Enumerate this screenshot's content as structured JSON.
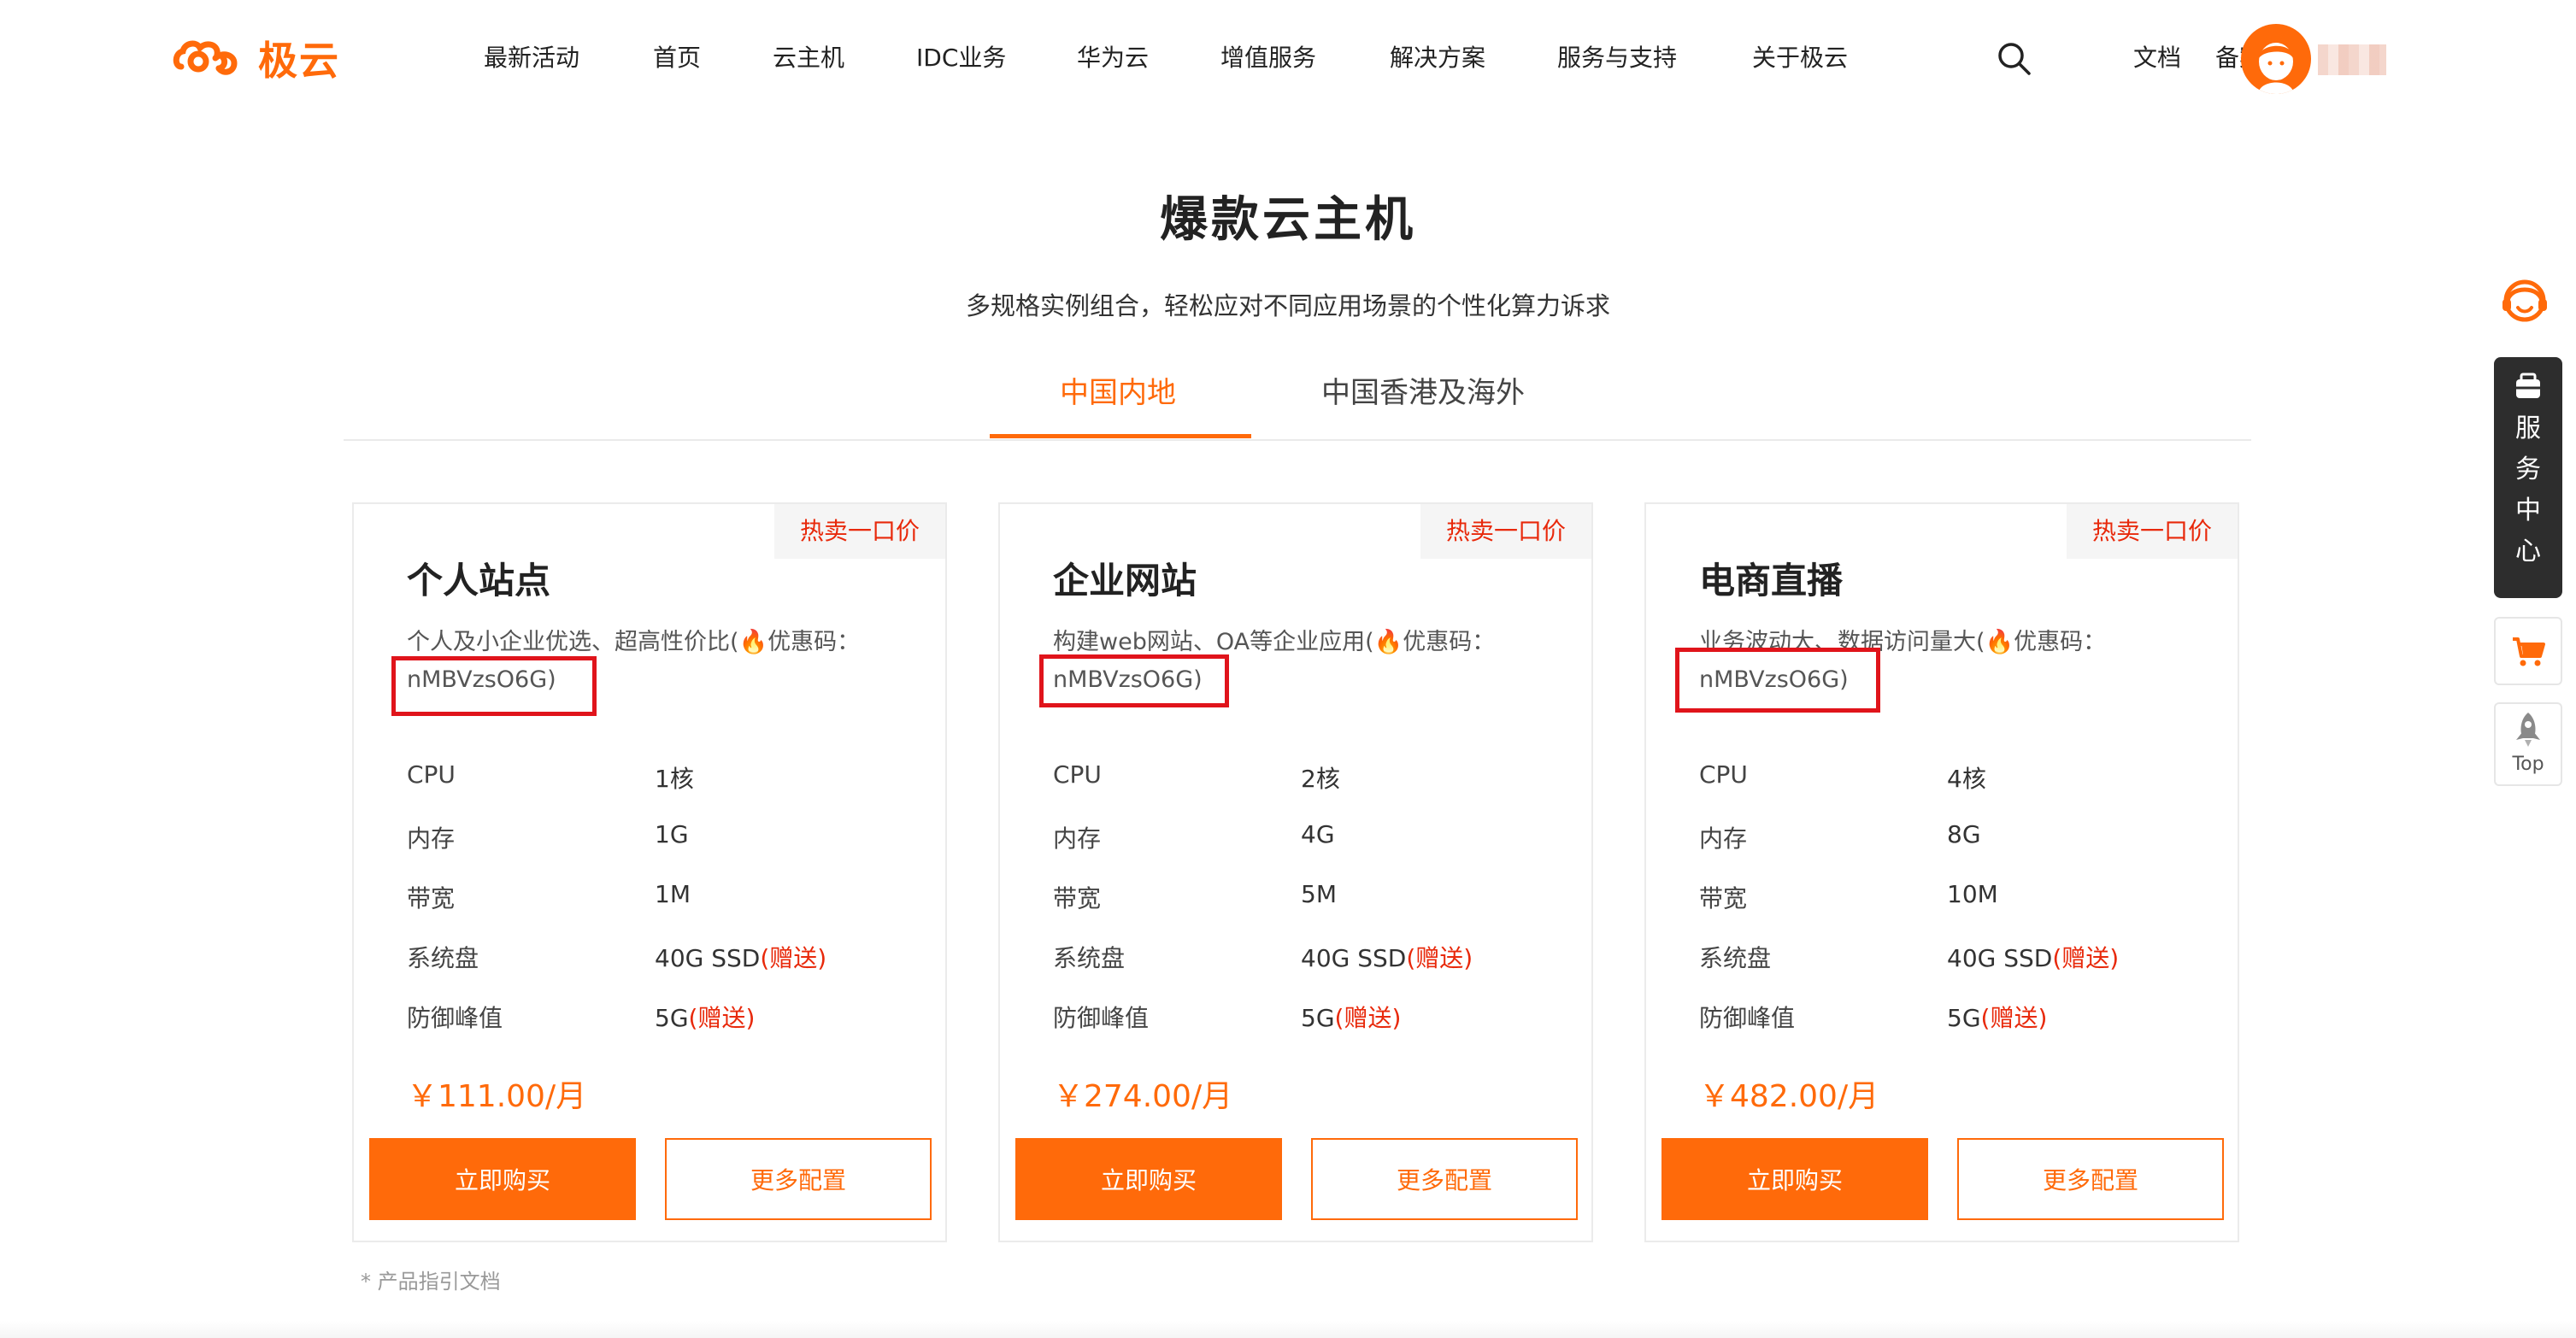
{
  "header": {
    "logo_text": "极云",
    "nav": [
      "最新活动",
      "首页",
      "云主机",
      "IDC业务",
      "华为云",
      "增值服务",
      "解决方案",
      "服务与支持",
      "关于极云"
    ],
    "docs_label": "文档",
    "record_label": "备案"
  },
  "hero": {
    "title": "爆款云主机",
    "subtitle": "多规格实例组合，轻松应对不同应用场景的个性化算力诉求"
  },
  "tabs": [
    {
      "label": "中国内地",
      "active": true
    },
    {
      "label": "中国香港及海外",
      "active": false
    }
  ],
  "cards": [
    {
      "badge": "热卖一口价",
      "title": "个人站点",
      "desc_text": "个人及小企业优选、超高性价比(",
      "desc_fire": "🔥",
      "desc_suffix": "优惠码：",
      "promo_code": "nMBVzsO6G)",
      "specs": [
        {
          "label": "CPU",
          "value": "1核",
          "gift": ""
        },
        {
          "label": "内存",
          "value": "1G",
          "gift": ""
        },
        {
          "label": "带宽",
          "value": "1M",
          "gift": ""
        },
        {
          "label": "系统盘",
          "value": "40G SSD",
          "gift": "(赠送)"
        },
        {
          "label": "防御峰值",
          "value": "5G",
          "gift": "(赠送)"
        }
      ],
      "price": "￥111.00/月",
      "buy_label": "立即购买",
      "more_label": "更多配置"
    },
    {
      "badge": "热卖一口价",
      "title": "企业网站",
      "desc_text": "构建web网站、OA等企业应用(",
      "desc_fire": "🔥",
      "desc_suffix": "优惠码：",
      "promo_code": "nMBVzsO6G)",
      "specs": [
        {
          "label": "CPU",
          "value": "2核",
          "gift": ""
        },
        {
          "label": "内存",
          "value": "4G",
          "gift": ""
        },
        {
          "label": "带宽",
          "value": "5M",
          "gift": ""
        },
        {
          "label": "系统盘",
          "value": "40G SSD",
          "gift": "(赠送)"
        },
        {
          "label": "防御峰值",
          "value": "5G",
          "gift": "(赠送)"
        }
      ],
      "price": "￥274.00/月",
      "buy_label": "立即购买",
      "more_label": "更多配置"
    },
    {
      "badge": "热卖一口价",
      "title": "电商直播",
      "desc_text": "业务波动大、数据访问量大(",
      "desc_fire": "🔥",
      "desc_suffix": "优惠码：",
      "promo_code": "nMBVzsO6G)",
      "specs": [
        {
          "label": "CPU",
          "value": "4核",
          "gift": ""
        },
        {
          "label": "内存",
          "value": "8G",
          "gift": ""
        },
        {
          "label": "带宽",
          "value": "10M",
          "gift": ""
        },
        {
          "label": "系统盘",
          "value": "40G SSD",
          "gift": "(赠送)"
        },
        {
          "label": "防御峰值",
          "value": "5G",
          "gift": "(赠送)"
        }
      ],
      "price": "￥482.00/月",
      "buy_label": "立即购买",
      "more_label": "更多配置"
    }
  ],
  "doc_link": "* 产品指引文档",
  "sidebar": {
    "service_center": [
      "服",
      "务",
      "中",
      "心"
    ],
    "top_label": "Top"
  },
  "icons": {
    "logo": "cloud-logo-icon",
    "search": "search-icon",
    "support": "customer-support-icon",
    "service": "service-icon",
    "cart": "cart-icon",
    "top": "rocket-icon"
  },
  "colors": {
    "accent": "#ff6a0a",
    "badge_text": "#e8290b",
    "highlight_box": "#e0141b",
    "service_bg": "#2d2d2d"
  }
}
